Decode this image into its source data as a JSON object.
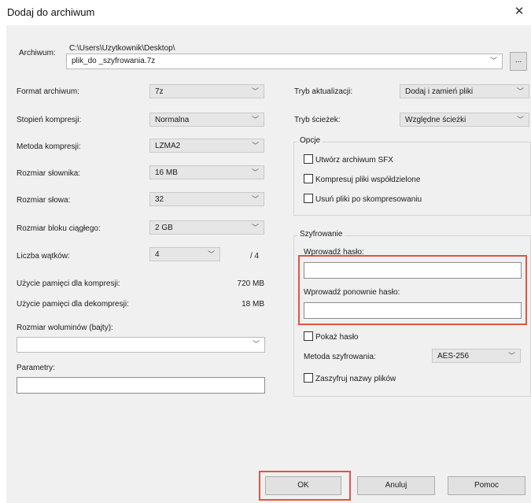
{
  "window": {
    "title": "Dodaj do archiwum",
    "close_glyph": "✕"
  },
  "archive": {
    "label": "Archiwum:",
    "path": "C:\\Users\\Uzytkownik\\Desktop\\",
    "filename": "plik_do _szyfrowania.7z",
    "browse_label": "..."
  },
  "left": {
    "format": {
      "label": "Format archiwum:",
      "value": "7z"
    },
    "level": {
      "label": "Stopień kompresji:",
      "value": "Normalna"
    },
    "method": {
      "label": "Metoda kompresji:",
      "value": "LZMA2"
    },
    "dict": {
      "label": "Rozmiar słownika:",
      "value": "16 MB"
    },
    "word": {
      "label": "Rozmiar słowa:",
      "value": "32"
    },
    "block": {
      "label": "Rozmiar bloku ciągłego:",
      "value": "2 GB"
    },
    "threads": {
      "label": "Liczba wątków:",
      "value": "4",
      "max": "/ 4"
    },
    "mem_comp": {
      "label": "Użycie pamięci dla kompresji:",
      "value": "720 MB"
    },
    "mem_decomp": {
      "label": "Użycie pamięci dla dekompresji:",
      "value": "18 MB"
    },
    "volumes": {
      "label": "Rozmiar woluminów (bajty):",
      "value": ""
    },
    "params": {
      "label": "Parametry:",
      "value": ""
    }
  },
  "right": {
    "update": {
      "label": "Tryb aktualizacji:",
      "value": "Dodaj i zamień pliki"
    },
    "paths": {
      "label": "Tryb ścieżek:",
      "value": "Względne ścieżki"
    },
    "options": {
      "title": "Opcje",
      "sfx": "Utwórz archiwum SFX",
      "shared": "Kompresuj pliki współdzielone",
      "delete": "Usuń pliki po skompresowaniu"
    },
    "encryption": {
      "title": "Szyfrowanie",
      "password_label": "Wprowadź hasło:",
      "password_value": "",
      "repeat_label": "Wprowadź ponownie hasło:",
      "repeat_value": "",
      "show_password": "Pokaż hasło",
      "method_label": "Metoda szyfrowania:",
      "method_value": "AES-256",
      "encrypt_names": "Zaszyfruj nazwy plików"
    }
  },
  "buttons": {
    "ok": "OK",
    "cancel": "Anuluj",
    "help": "Pomoc"
  },
  "glyphs": {
    "chevron": "﹀"
  },
  "colors": {
    "highlight": "#e05545",
    "dialog_bg": "#f0f0f0"
  }
}
